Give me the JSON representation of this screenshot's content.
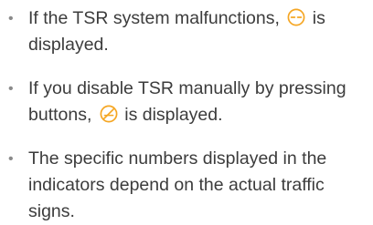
{
  "colors": {
    "text": "#3c3c3c",
    "bullet": "#8a8a8a",
    "icon_accent": "#f5a623"
  },
  "items": [
    {
      "before": "If the TSR system malfunctions,",
      "icon": "tsr-malfunction-icon",
      "after": "is displayed."
    },
    {
      "before": "If you disable TSR manually by pressing buttons,",
      "icon": "tsr-disabled-icon",
      "after": "is displayed."
    },
    {
      "text": "The specific numbers displayed in the indicators depend on the actual traffic signs."
    }
  ]
}
